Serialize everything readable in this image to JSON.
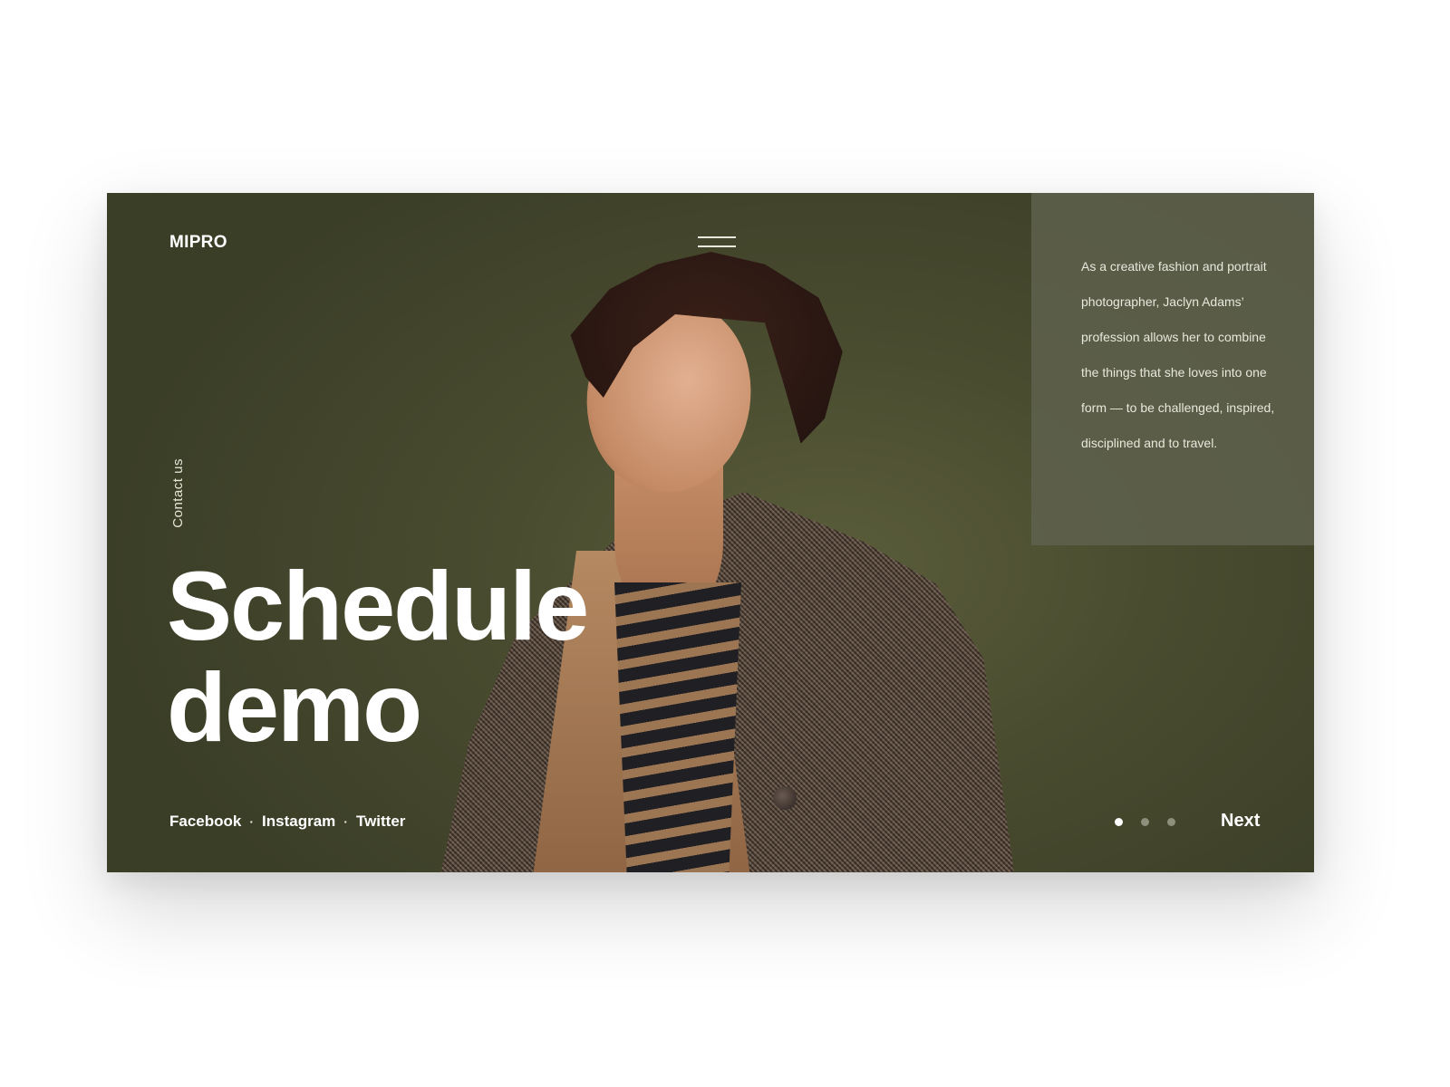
{
  "brand": {
    "logo": "MIPRO"
  },
  "header": {
    "menu_icon": "hamburger-menu-icon"
  },
  "sidebar": {
    "contact_label": "Contact us"
  },
  "hero": {
    "headline_line1": "Schedule",
    "headline_line2": "demo",
    "image_description": "Portrait of a model with dark tousled hair wearing a houndstooth coat over a striped sweater against an olive background"
  },
  "info_panel": {
    "text": "As a creative fashion and portrait photographer, Jaclyn Adams’ profession allows her to combine the things that she loves into one form — to be challenged, inspired, disciplined and to travel."
  },
  "social": {
    "links": [
      "Facebook",
      "Instagram",
      "Twitter"
    ],
    "separator": "·"
  },
  "pagination": {
    "total": 3,
    "current": 1
  },
  "navigation": {
    "next_label": "Next"
  },
  "colors": {
    "background": "#4a4c30",
    "panel": "#5f624e",
    "text": "#ffffff",
    "muted_text": "#e8e8dc",
    "dot_inactive": "#8e8f7c"
  }
}
